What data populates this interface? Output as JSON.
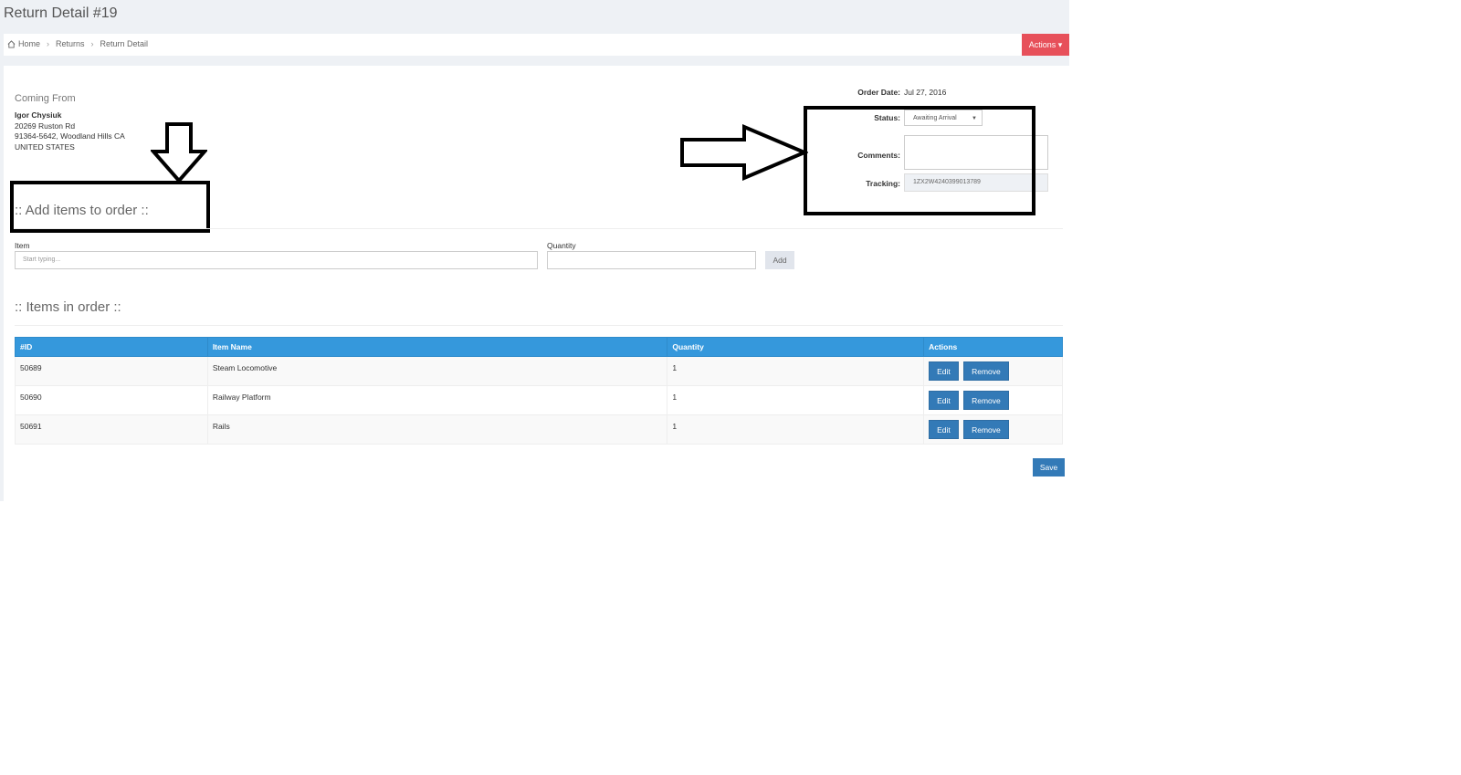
{
  "header": {
    "title": "Return Detail #19"
  },
  "breadcrumb": {
    "home": "Home",
    "returns": "Returns",
    "current": "Return Detail",
    "separator": "›"
  },
  "actions_button": {
    "label": "Actions ▾"
  },
  "coming_from": {
    "title": "Coming From",
    "name": "Igor Chysiuk",
    "street": "20269 Ruston Rd",
    "city_line": "91364-5642, Woodland Hills CA",
    "country": "UNITED STATES"
  },
  "order_info": {
    "order_date_label": "Order Date:",
    "order_date_value": "Jul 27, 2016",
    "status_label": "Status:",
    "status_value": "Awaiting Arrival",
    "comments_label": "Comments:",
    "comments_value": "",
    "tracking_label": "Tracking:",
    "tracking_value": "1ZX2W4240399013789"
  },
  "add_items": {
    "title": ":: Add items to order ::",
    "item_label": "Item",
    "item_placeholder": "Start typing...",
    "quantity_label": "Quantity",
    "add_button": "Add"
  },
  "items_in_order": {
    "title": ":: Items in order ::",
    "columns": [
      "#ID",
      "Item Name",
      "Quantity",
      "Actions"
    ],
    "rows": [
      {
        "id": "50689",
        "name": "Steam Locomotive",
        "quantity": "1"
      },
      {
        "id": "50690",
        "name": "Railway Platform",
        "quantity": "1"
      },
      {
        "id": "50691",
        "name": "Rails",
        "quantity": "1"
      }
    ],
    "edit_label": "Edit",
    "remove_label": "Remove"
  },
  "save_button": "Save",
  "colors": {
    "actions_red": "#e7505a",
    "table_header_blue": "#3598dc",
    "button_blue": "#337ab7"
  }
}
